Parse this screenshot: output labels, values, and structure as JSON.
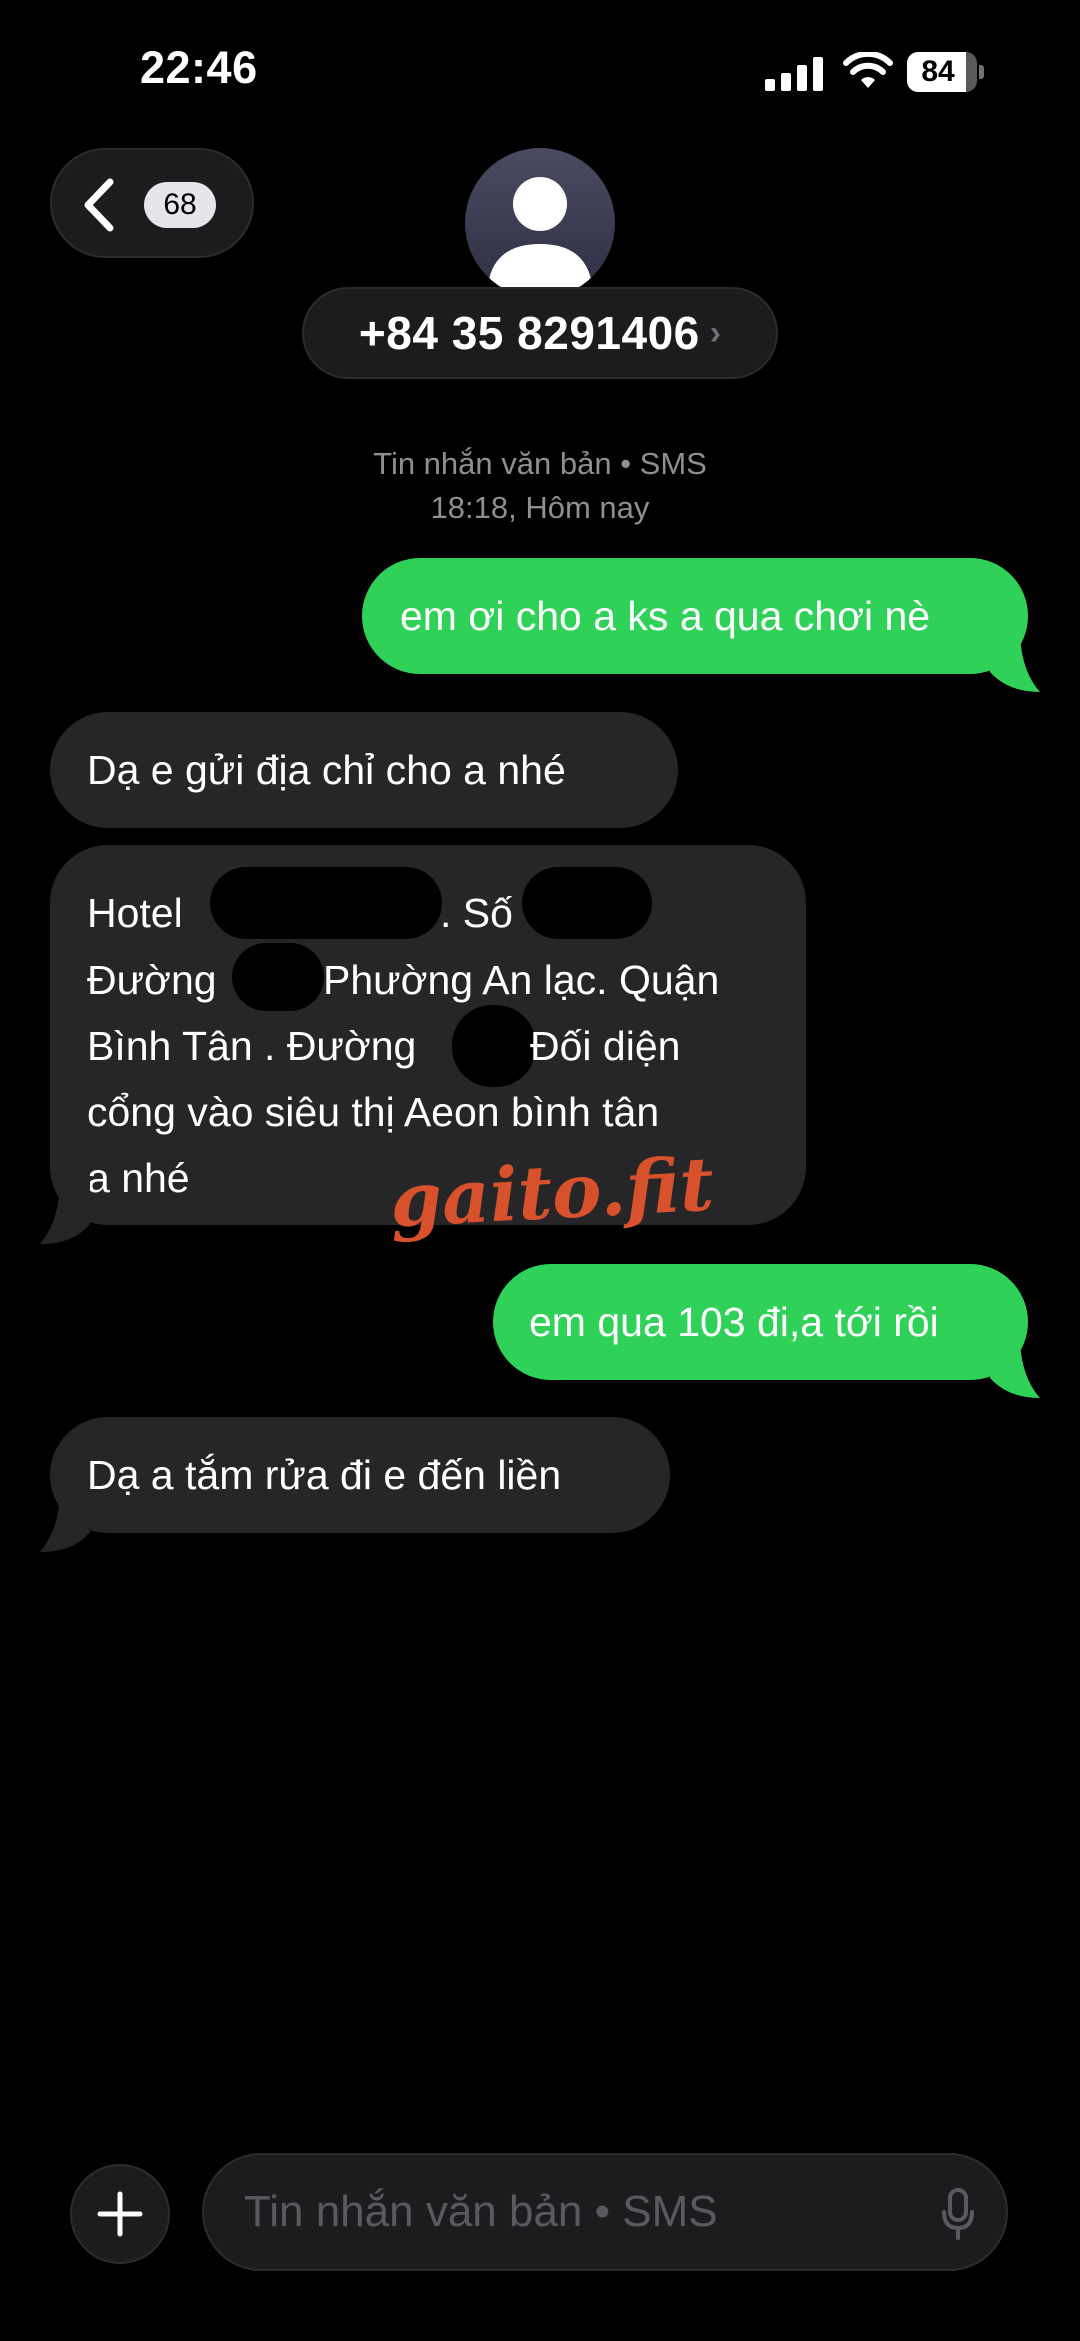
{
  "status_bar": {
    "time": "22:46",
    "battery_percent": "84",
    "battery_level": 0.84
  },
  "header": {
    "back_badge": "68",
    "contact": "+84 35 8291406",
    "contact_chevron": "›"
  },
  "meta": {
    "service": "Tin nhắn văn bản • SMS",
    "timestamp": "18:18, Hôm nay"
  },
  "messages": [
    {
      "direction": "outgoing",
      "text": "em ơi cho a ks a qua chơi nè"
    },
    {
      "direction": "incoming",
      "text": "Dạ e gửi địa chỉ cho a nhé"
    },
    {
      "direction": "incoming",
      "lines": [
        "Hotel",
        ". Số",
        "Đường",
        "Phường An lạc. Quận",
        "Bình Tân . Đường",
        "Đối diện",
        "cổng vào siêu thị Aeon bình tân",
        "a nhé"
      ]
    },
    {
      "direction": "outgoing",
      "text": "em qua 103 đi,a tới rồi"
    },
    {
      "direction": "incoming",
      "text": "Dạ a tắm rửa đi e đến liền"
    }
  ],
  "watermark": "gaito.fit",
  "composer": {
    "placeholder": "Tin nhắn văn bản • SMS"
  },
  "colors": {
    "outgoing_bubble": "#30d158",
    "incoming_bubble": "#262628",
    "background": "#000000",
    "watermark": "#d6512c"
  },
  "icons": [
    "back-chevron-icon",
    "person-icon",
    "plus-icon",
    "mic-icon",
    "wifi-icon",
    "signal-icon",
    "battery-icon"
  ]
}
